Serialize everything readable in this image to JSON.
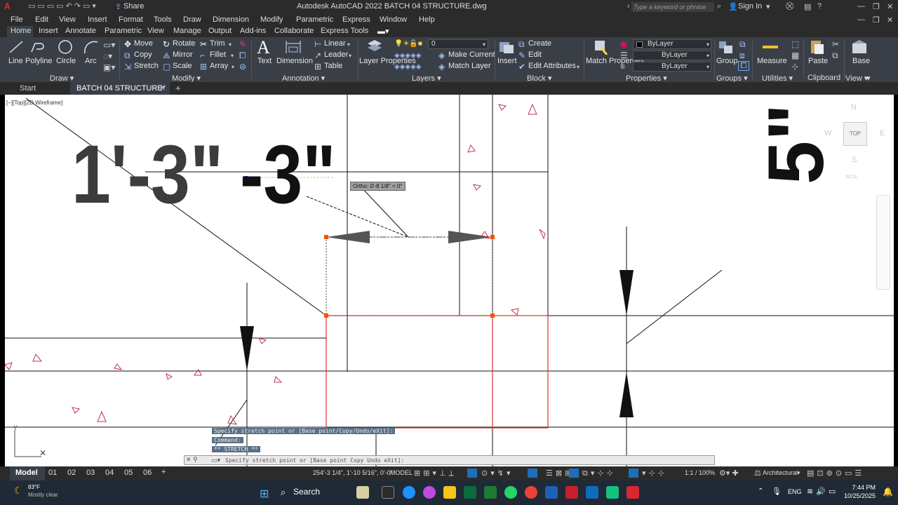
{
  "app": {
    "title": "Autodesk AutoCAD 2022   BATCH 04 STRUCTURE.dwg",
    "share_label": "Share",
    "search_placeholder": "Type a keyword or phrase",
    "sign_in_label": "Sign In"
  },
  "menu": [
    "File",
    "Edit",
    "View",
    "Insert",
    "Format",
    "Tools",
    "Draw",
    "Dimension",
    "Modify",
    "Parametric",
    "Express",
    "Window",
    "Help"
  ],
  "ribbon_tabs": [
    "Home",
    "Insert",
    "Annotate",
    "Parametric",
    "View",
    "Manage",
    "Output",
    "Add-ins",
    "Collaborate",
    "Express Tools"
  ],
  "ribbon": {
    "draw": {
      "line": "Line",
      "polyline": "Polyline",
      "circle": "Circle",
      "arc": "Arc",
      "group": "Draw"
    },
    "modify": {
      "move": "Move",
      "rotate": "Rotate",
      "trim": "Trim",
      "copy": "Copy",
      "mirror": "Mirror",
      "fillet": "Fillet",
      "stretch": "Stretch",
      "scale": "Scale",
      "array": "Array",
      "group": "Modify"
    },
    "annotation": {
      "text": "Text",
      "dimension": "Dimension",
      "linear": "Linear",
      "leader": "Leader",
      "table": "Table",
      "group": "Annotation"
    },
    "layers": {
      "layer_properties": "Layer Properties",
      "current_layer": "0",
      "make_current": "Make Current",
      "match_layer": "Match Layer",
      "group": "Layers"
    },
    "block": {
      "insert": "Insert",
      "create": "Create",
      "edit": "Edit",
      "edit_attributes": "Edit Attributes",
      "group": "Block"
    },
    "properties": {
      "match_properties": "Match Properties",
      "color": "ByLayer",
      "linetype": "ByLayer",
      "lineweight": "ByLayer",
      "group": "Properties"
    },
    "groups": {
      "group_btn": "Group",
      "group": "Groups"
    },
    "utilities": {
      "measure": "Measure",
      "group": "Utilities"
    },
    "clipboard": {
      "paste": "Paste",
      "group": "Clipboard"
    },
    "view": {
      "base": "Base",
      "group": "View"
    }
  },
  "doc_tabs": {
    "start": "Start",
    "active": "BATCH 04 STRUCTURE*"
  },
  "viewport_label": "[−][Top][2D Wireframe]",
  "viewcube": {
    "n": "N",
    "s": "S",
    "e": "E",
    "w": "W",
    "top": "TOP",
    "wcs": "WCS"
  },
  "drawing": {
    "dim_left": "1'-3\"",
    "dim_right": "-3\"",
    "dim_vertical": "5\"",
    "tooltip": "Ortho: 0'-8 1/8\" < 0°"
  },
  "command": {
    "history1": "Specify stretch point or [Base point/Copy/Undo/eXit]:",
    "history2": "Command:",
    "history3": "** STRETCH **",
    "prompt": "Specify stretch point or [Base point Copy Undo eXit]:"
  },
  "status": {
    "model_tab": "Model",
    "layouts": [
      "01",
      "02",
      "03",
      "04",
      "05",
      "06"
    ],
    "coords": "254'-3 1/4\", 1'-10 5/16\", 0'-0\"",
    "model_label": "MODEL",
    "scale": "1:1 / 100%",
    "units": "Architectural"
  },
  "taskbar": {
    "weather_temp": "83°F",
    "weather_desc": "Mostly clear",
    "search_label": "Search",
    "lang": "ENG",
    "time": "7:44 PM",
    "date": "10/25/2025"
  },
  "colors": {
    "accent": "#0a7bd6",
    "selection_red": "#e03030",
    "grip": "#ff4d00"
  }
}
